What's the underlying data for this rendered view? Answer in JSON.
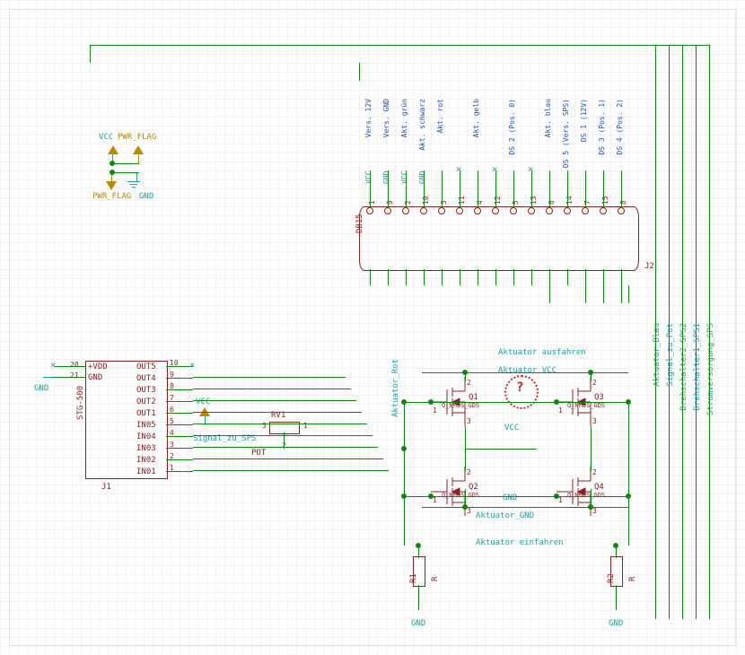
{
  "flags": {
    "vcc": "VCC",
    "pwr_flag_1": "PWR_FLAG",
    "pwr_flag_2": "PWR_FLAG",
    "gnd": "GND"
  },
  "j1": {
    "ref": "J1",
    "value": "STG-500",
    "left_nums": [
      "20",
      "21"
    ],
    "left_pins": [
      "+VDD",
      "GND"
    ],
    "right_nums": [
      "10",
      "9",
      "8",
      "7",
      "6",
      "5",
      "4",
      "3",
      "2",
      "1"
    ],
    "right_pins": [
      "OUT5",
      "OUT4",
      "OUT3",
      "OUT2",
      "OUT1",
      "IN05",
      "IN04",
      "IN03",
      "IN02",
      "IN01"
    ],
    "gnd_label": "GND",
    "vcc_label": "VCC"
  },
  "rv1": {
    "ref": "RV1",
    "value": "POT",
    "pins": [
      "1",
      "2",
      "3"
    ],
    "net": "Signal_zu_SPS"
  },
  "j2": {
    "ref": "J2",
    "value": "DB15",
    "pin_nums": [
      "1",
      "9",
      "2",
      "10",
      "3",
      "11",
      "4",
      "12",
      "5",
      "13",
      "6",
      "14",
      "7",
      "15",
      "8"
    ],
    "pin_labels": [
      "Vers. 12V",
      "Vers. GND",
      "Akt. grün",
      "Akt. schwarz",
      "Akt. rot",
      "Akt. gelb",
      "DS 2 (Pos. 0)",
      "Akt. blau",
      "DS 5 (Vers. SPS)",
      "DS 1 (12V)",
      "DS 3 (Pos. 1)",
      "DS 4 (Pos. 2)"
    ],
    "rail_labels": [
      "VCC",
      "GND",
      "VCC",
      "GND"
    ]
  },
  "nets": {
    "akt_rot": "Aktuator_Rot",
    "akt_ausf": "Aktuator ausfahren",
    "akt_einf": "Aktuator einfahren",
    "akt_vcc": "Aktuator VCC",
    "akt_gnd": "Aktuator_GND",
    "vcc": "VCC",
    "gnd": "GND",
    "r_vcc": "VCC",
    "akt_blau": "Aktuator_Blau",
    "sig_pot": "Signal_zu_Pot",
    "dreh2": "Drehschalter2_SPS2",
    "dreh1": "Drehschalter1_SPS1",
    "strom": "Stromversorgung_SPS"
  },
  "mos": {
    "q1": {
      "ref": "Q1",
      "value": "Q_NMOS_GDS",
      "pins": [
        "1",
        "2",
        "3"
      ]
    },
    "q2": {
      "ref": "Q2",
      "value": "Q_NMOS_GDS",
      "pins": [
        "1",
        "2",
        "3"
      ]
    },
    "q3": {
      "ref": "Q3",
      "value": "Q_NMOS_GDS",
      "pins": [
        "1",
        "2",
        "3"
      ]
    },
    "q4": {
      "ref": "Q4",
      "value": "Q_NMOS_GDS",
      "pins": [
        "1",
        "2",
        "3"
      ]
    }
  },
  "r": {
    "r1": {
      "ref": "R1",
      "value": "R",
      "gnd": "GND"
    },
    "r2": {
      "ref": "R2",
      "value": "R",
      "gnd": "GND"
    }
  },
  "erc_mark": "?"
}
